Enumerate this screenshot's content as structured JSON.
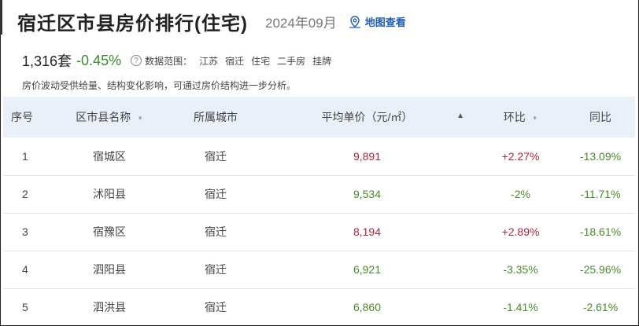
{
  "header": {
    "title": "宿迁区市县房价排行(住宅)",
    "period": "2024年09月",
    "map_link": "地图查看"
  },
  "summary": {
    "count": "1,316套",
    "change": "-0.45%",
    "scope_label": "数据范围：",
    "scope_items": [
      "江苏",
      "宿迁",
      "住宅",
      "二手房",
      "挂牌"
    ],
    "note": "房价波动受供给量、结构变化影响，可通过房价结构进一步分析。"
  },
  "table": {
    "columns": [
      "序号",
      "区市县名称",
      "所属城市",
      "平均单价（元/㎡）",
      "环比",
      "同比"
    ],
    "rows": [
      {
        "idx": "1",
        "name": "宿城区",
        "city": "宿迁",
        "price": "9,891",
        "mom": "+2.27%",
        "yoy": "-13.09%"
      },
      {
        "idx": "2",
        "name": "沭阳县",
        "city": "宿迁",
        "price": "9,534",
        "mom": "-2%",
        "yoy": "-11.71%"
      },
      {
        "idx": "3",
        "name": "宿豫区",
        "city": "宿迁",
        "price": "8,194",
        "mom": "+2.89%",
        "yoy": "-18.61%"
      },
      {
        "idx": "4",
        "name": "泗阳县",
        "city": "宿迁",
        "price": "6,921",
        "mom": "-3.35%",
        "yoy": "-25.96%"
      },
      {
        "idx": "5",
        "name": "泗洪县",
        "city": "宿迁",
        "price": "6,860",
        "mom": "-1.41%",
        "yoy": "-2.61%"
      }
    ]
  },
  "colors": {
    "rise": "#b0253a",
    "fall": "#4a8a2a",
    "header_bg": "#e9f0fa",
    "link": "#1f5fb0"
  }
}
